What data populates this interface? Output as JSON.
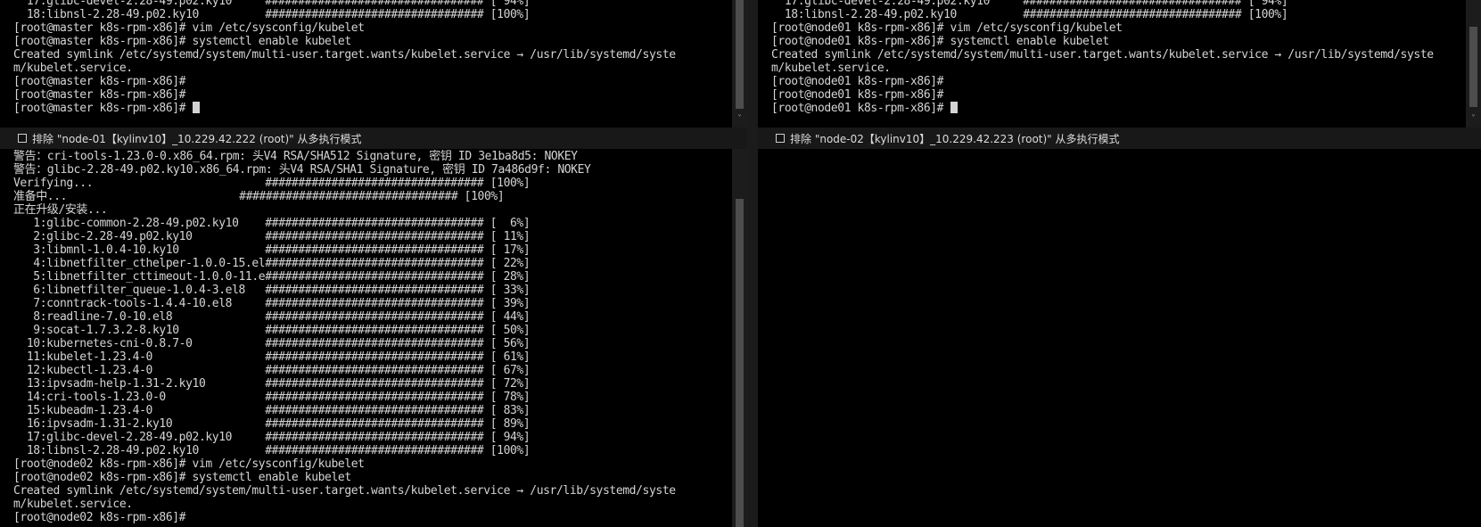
{
  "panes": {
    "top_left": {
      "lines": [
        "  17:glibc-devel-2.28-49.p02.ky10     ################################# [ 94%]",
        "  18:libnsl-2.28-49.p02.ky10          ################################# [100%]",
        "[root@master k8s-rpm-x86]# vim /etc/sysconfig/kubelet",
        "[root@master k8s-rpm-x86]# systemctl enable kubelet",
        "Created symlink /etc/systemd/system/multi-user.target.wants/kubelet.service → /usr/lib/systemd/syste",
        "m/kubelet.service.",
        "[root@master k8s-rpm-x86]#",
        "[root@master k8s-rpm-x86]#",
        "[root@master k8s-rpm-x86]# "
      ]
    },
    "top_right": {
      "lines": [
        "  17:glibc-devel-2.28-49.p02.ky10     ################################# [ 94%]",
        "  18:libnsl-2.28-49.p02.ky10          ################################# [100%]",
        "[root@node01 k8s-rpm-x86]# vim /etc/sysconfig/kubelet",
        "[root@node01 k8s-rpm-x86]# systemctl enable kubelet",
        "Created symlink /etc/systemd/system/multi-user.target.wants/kubelet.service → /usr/lib/systemd/syste",
        "m/kubelet.service.",
        "[root@node01 k8s-rpm-x86]#",
        "[root@node01 k8s-rpm-x86]#",
        "[root@node01 k8s-rpm-x86]# "
      ]
    },
    "bottom_left": {
      "exclude_label": "排除 \"node-01【kylinv10】_10.229.42.222 (root)\" 从多执行模式",
      "lines": [
        "警告：cri-tools-1.23.0-0.x86_64.rpm: 头V4 RSA/SHA512 Signature, 密钥 ID 3e1ba8d5: NOKEY",
        "警告：glibc-2.28-49.p02.ky10.x86_64.rpm: 头V4 RSA/SHA1 Signature, 密钥 ID 7a486d9f: NOKEY",
        "Verifying...                          ################################# [100%]",
        "准备中...                          ################################# [100%]",
        "正在升级/安装...",
        "   1:glibc-common-2.28-49.p02.ky10    ################################# [  6%]",
        "   2:glibc-2.28-49.p02.ky10           ################################# [ 11%]",
        "   3:libmnl-1.0.4-10.ky10             ################################# [ 17%]",
        "   4:libnetfilter_cthelper-1.0.0-15.el################################# [ 22%]",
        "   5:libnetfilter_cttimeout-1.0.0-11.e################################# [ 28%]",
        "   6:libnetfilter_queue-1.0.4-3.el8   ################################# [ 33%]",
        "   7:conntrack-tools-1.4.4-10.el8     ################################# [ 39%]",
        "   8:readline-7.0-10.el8              ################################# [ 44%]",
        "   9:socat-1.7.3.2-8.ky10             ################################# [ 50%]",
        "  10:kubernetes-cni-0.8.7-0           ################################# [ 56%]",
        "  11:kubelet-1.23.4-0                 ################################# [ 61%]",
        "  12:kubectl-1.23.4-0                 ################################# [ 67%]",
        "  13:ipvsadm-help-1.31-2.ky10         ################################# [ 72%]",
        "  14:cri-tools-1.23.0-0               ################################# [ 78%]",
        "  15:kubeadm-1.23.4-0                 ################################# [ 83%]",
        "  16:ipvsadm-1.31-2.ky10              ################################# [ 89%]",
        "  17:glibc-devel-2.28-49.p02.ky10     ################################# [ 94%]",
        "  18:libnsl-2.28-49.p02.ky10          ################################# [100%]",
        "[root@node02 k8s-rpm-x86]# vim /etc/sysconfig/kubelet",
        "[root@node02 k8s-rpm-x86]# systemctl enable kubelet",
        "Created symlink /etc/systemd/system/multi-user.target.wants/kubelet.service → /usr/lib/systemd/syste",
        "m/kubelet.service.",
        "[root@node02 k8s-rpm-x86]#"
      ]
    },
    "bottom_right": {
      "exclude_label": "排除 \"node-02【kylinv10】_10.229.42.223 (root)\" 从多执行模式",
      "lines": []
    }
  }
}
